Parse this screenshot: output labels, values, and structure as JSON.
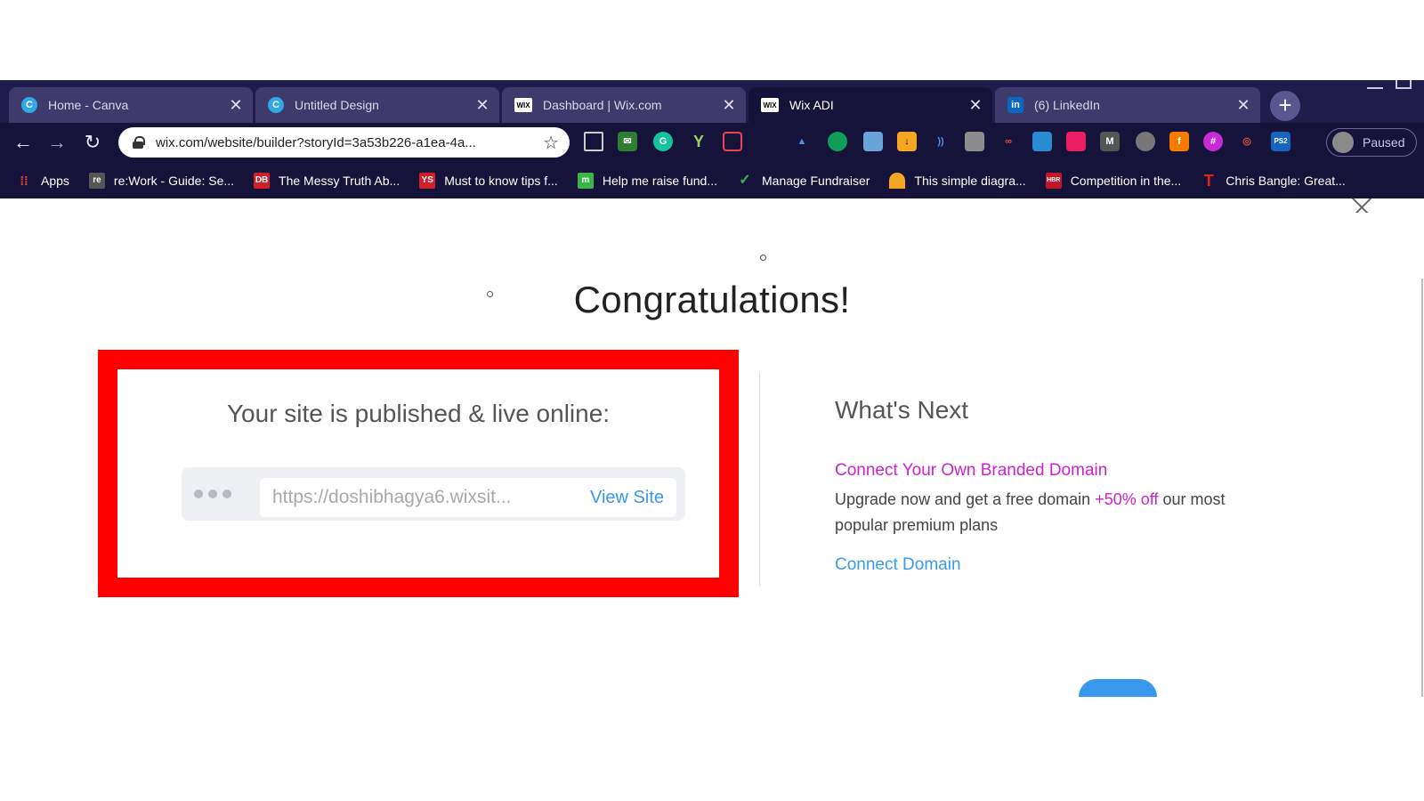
{
  "browser": {
    "tabs": [
      {
        "title": "Home - Canva",
        "icon": "canva-icon",
        "active": false
      },
      {
        "title": "Untitled Design",
        "icon": "canva-icon",
        "active": false
      },
      {
        "title": "Dashboard | Wix.com",
        "icon": "wix-icon",
        "active": false
      },
      {
        "title": "Wix ADI",
        "icon": "wix-icon",
        "active": true
      },
      {
        "title": "(6) LinkedIn",
        "icon": "linkedin-icon",
        "active": false
      }
    ],
    "close_glyph": "✕",
    "newtab_glyph": "+",
    "address_url": "wix.com/website/builder?storyId=3a53b226-a1ea-4a...",
    "profile_status": "Paused",
    "bookmarks": [
      {
        "label": "Apps",
        "icon": "apps-grid-icon",
        "color": "#e84c3d"
      },
      {
        "label": "re:Work - Guide: Se...",
        "icon": "rework-icon",
        "color": "#555555"
      },
      {
        "label": "The Messy Truth Ab...",
        "icon": "db-icon",
        "color": "#d11f2a"
      },
      {
        "label": "Must to know tips f...",
        "icon": "ys-icon",
        "color": "#d11f2a"
      },
      {
        "label": "Help me raise fund...",
        "icon": "fundraiser-icon",
        "color": "#3bb54a"
      },
      {
        "label": "Manage Fundraiser",
        "icon": "fundraiser-check-icon",
        "color": "#3bb54a"
      },
      {
        "label": "This simple diagra...",
        "icon": "nbc-icon",
        "color": "#f5a623"
      },
      {
        "label": "Competition in the...",
        "icon": "hbr-icon",
        "color": "#c0152a"
      },
      {
        "label": "Chris Bangle: Great...",
        "icon": "t-icon",
        "color": "#e2231a"
      }
    ]
  },
  "page": {
    "headline": "Congratulations!",
    "published": {
      "title": "Your site is published & live online:",
      "site_url": "https://doshibhagya6.wixsit...",
      "view_site": "View Site"
    },
    "next": {
      "title": "What's Next",
      "domain_link": "Connect Your Own Branded Domain",
      "desc_before": "Upgrade now and get a free domain ",
      "desc_promo": "+50% off",
      "desc_after": " our most popular premium plans",
      "connect_link": "Connect Domain"
    },
    "colors": {
      "highlight": "#ff0000",
      "link_blue": "#3899ec",
      "promo_magenta": "#cc22cc"
    }
  }
}
